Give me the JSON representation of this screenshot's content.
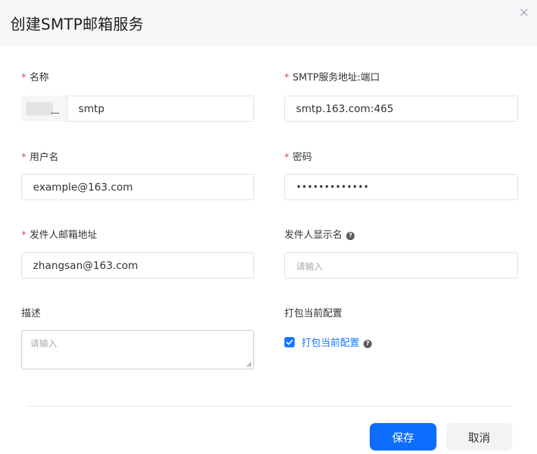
{
  "dialog": {
    "title": "创建SMTP邮箱服务"
  },
  "form": {
    "required_mark": "*",
    "name": {
      "label": "名称",
      "value": "smtp"
    },
    "smtp_address": {
      "label": "SMTP服务地址:端口",
      "value": "smtp.163.com:465"
    },
    "username": {
      "label": "用户名",
      "value": "example@163.com"
    },
    "password": {
      "label": "密码",
      "value": "•••••••••••••"
    },
    "sender_email": {
      "label": "发件人邮箱地址",
      "value": "zhangsan@163.com"
    },
    "sender_display_name": {
      "label": "发件人显示名",
      "placeholder": "请输入",
      "help": "?"
    },
    "description": {
      "label": "描述",
      "placeholder": "请输入"
    },
    "package": {
      "label": "打包当前配置",
      "checkbox_label": "打包当前配置",
      "checked": true,
      "help": "?"
    }
  },
  "footer": {
    "save_label": "保存",
    "cancel_label": "取消"
  },
  "colors": {
    "primary": "#0d6efd",
    "required": "#e5484d",
    "header_bg": "#f5f6f8"
  },
  "icons": {
    "close": "close-icon",
    "help": "help-icon",
    "check": "check-icon"
  }
}
